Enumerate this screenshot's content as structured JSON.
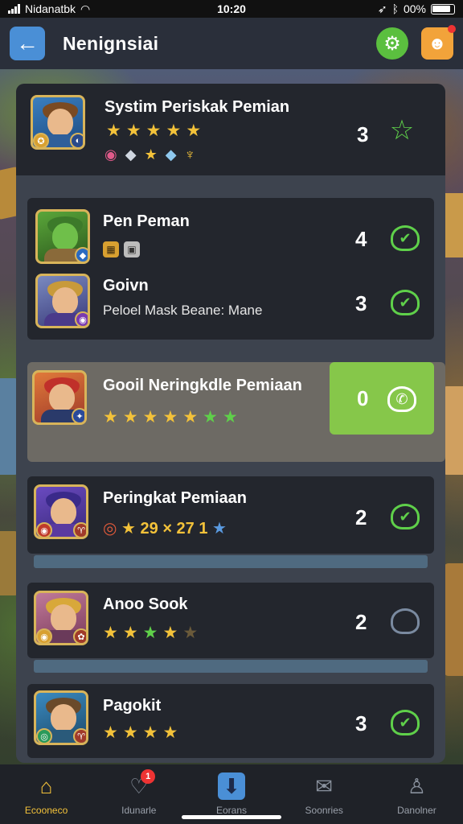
{
  "status_bar": {
    "carrier": "Nidanatbk",
    "time": "10:20",
    "battery": "00%",
    "icons": [
      "signal-icon",
      "wifi-icon",
      "location-icon",
      "bluetooth-icon",
      "battery-icon"
    ]
  },
  "header": {
    "title": "Nenignsiai",
    "icons": [
      "back-arrow-icon",
      "gear-icon",
      "profile-icon"
    ],
    "colors": {
      "back": "#4a8fd6",
      "settings": "#5bbf3f",
      "profile": "#f2a33a"
    }
  },
  "leaderboard": [
    {
      "name": "Systim Periskak Pemian",
      "stars": [
        "★",
        "★",
        "★",
        "★",
        "★"
      ],
      "gems": [
        "◉",
        "◆",
        "★",
        "◆",
        "♆"
      ],
      "count": "3",
      "status_icon": "star-outline-icon"
    },
    {
      "name": "Pen Pеman",
      "tiny_icons": [
        "▦",
        "▣"
      ],
      "count": "4",
      "status_icon": "check-heart-icon"
    },
    {
      "name": "Goivn",
      "subtext": "Peloel Mask Beane: Mane",
      "count": "3",
      "status_icon": "check-heart-icon"
    },
    {
      "name": "Gooil Neringkdle Pemiaan",
      "stars": [
        "★",
        "★",
        "★",
        "★",
        "★",
        "★",
        "★"
      ],
      "count": "0",
      "status_icon": "chat-bubble-icon",
      "highlighted": true
    },
    {
      "name": "Peringkat Pemiaan",
      "rating_text": "29 × 27 1",
      "count": "2",
      "status_icon": "check-heart-icon"
    },
    {
      "name": "Anoo Sook",
      "stars": [
        "★",
        "★",
        "★",
        "★",
        "★"
      ],
      "count": "2",
      "status_icon": "heart-outline-icon"
    },
    {
      "name": "Pagokit",
      "stars": [
        "★",
        "★",
        "★",
        "★"
      ],
      "count": "3",
      "status_icon": "check-heart-icon"
    }
  ],
  "bottom_nav": [
    {
      "label": "Ecooneco",
      "icon": "home-icon",
      "active": true
    },
    {
      "label": "Idunarle",
      "icon": "chat-icon",
      "badge": "1"
    },
    {
      "label": "Eorans",
      "icon": "download-icon"
    },
    {
      "label": "Soonries",
      "icon": "mail-icon"
    },
    {
      "label": "Danolner",
      "icon": "user-icon"
    }
  ],
  "colors": {
    "accent_green": "#5fd04a",
    "star_gold": "#f3c23a",
    "highlight_box": "#86c74a",
    "panel": "#3d434e",
    "row": "#23262d"
  }
}
